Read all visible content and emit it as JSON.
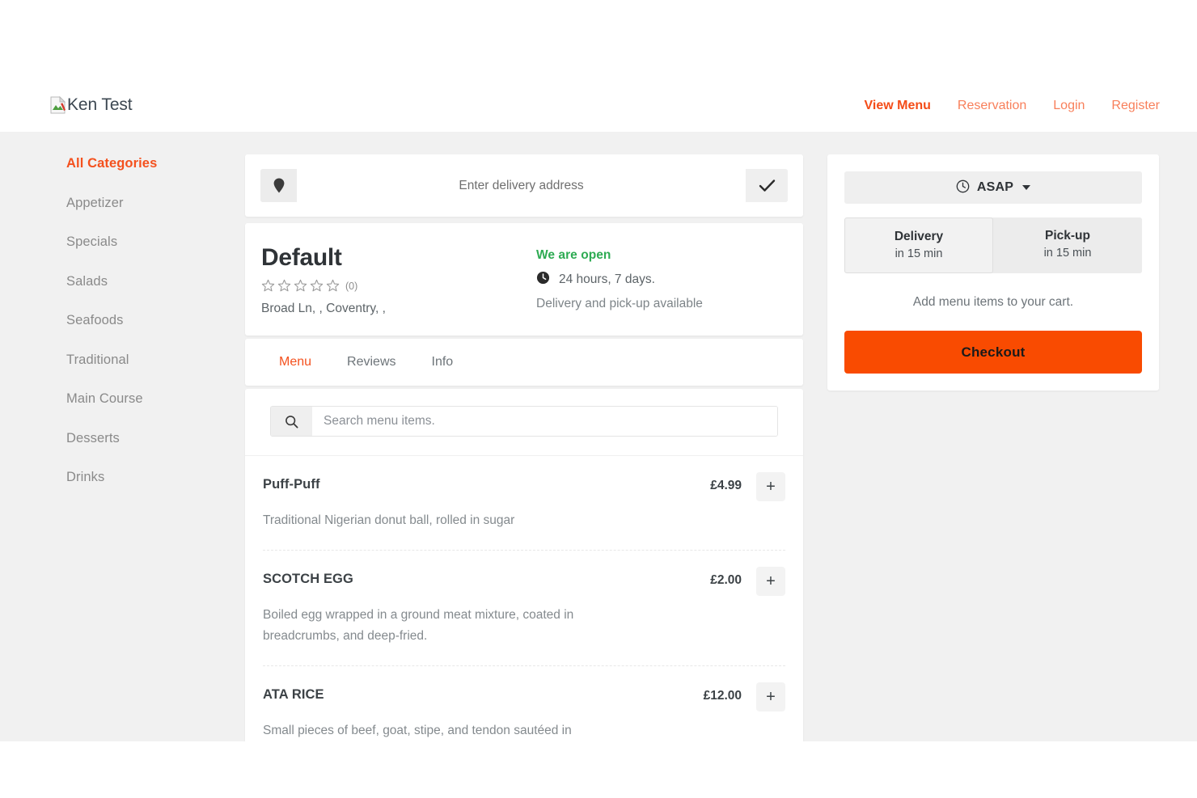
{
  "header": {
    "brand_alt": "Ken Test",
    "brand_icon": "broken-image-icon",
    "nav": [
      {
        "label": "View Menu",
        "active": true
      },
      {
        "label": "Reservation",
        "active": false
      },
      {
        "label": "Login",
        "active": false
      },
      {
        "label": "Register",
        "active": false
      }
    ]
  },
  "sidebar": {
    "items": [
      {
        "label": "All Categories",
        "active": true
      },
      {
        "label": "Appetizer",
        "active": false
      },
      {
        "label": "Specials",
        "active": false
      },
      {
        "label": "Salads",
        "active": false
      },
      {
        "label": "Seafoods",
        "active": false
      },
      {
        "label": "Traditional",
        "active": false
      },
      {
        "label": "Main Course",
        "active": false
      },
      {
        "label": "Desserts",
        "active": false
      },
      {
        "label": "Drinks",
        "active": false
      }
    ]
  },
  "address_bar": {
    "pin_icon": "location-pin-icon",
    "placeholder": "Enter delivery address",
    "value": "",
    "confirm_icon": "checkmark-icon"
  },
  "restaurant": {
    "name": "Default",
    "rating_stars": 0,
    "rating_count": "(0)",
    "address": "Broad Ln, , Coventry, ,",
    "open_status": "We are open",
    "clock_icon": "clock-icon",
    "hours": "24 hours, 7 days.",
    "availability": "Delivery and pick-up available"
  },
  "tabs": [
    {
      "label": "Menu",
      "active": true
    },
    {
      "label": "Reviews",
      "active": false
    },
    {
      "label": "Info",
      "active": false
    }
  ],
  "search": {
    "icon": "search-icon",
    "placeholder": "Search menu items.",
    "value": ""
  },
  "menu_items": [
    {
      "name": "Puff-Puff",
      "price": "£4.99",
      "description": "Traditional Nigerian donut ball, rolled in sugar",
      "add_label": "+"
    },
    {
      "name": "SCOTCH EGG",
      "price": "£2.00",
      "description": "Boiled egg wrapped in a ground meat mixture, coated in breadcrumbs, and deep-fried.",
      "add_label": "+"
    },
    {
      "name": "ATA RICE",
      "price": "£12.00",
      "description": "Small pieces of beef, goat, stipe, and tendon sautéed in",
      "add_label": "+"
    }
  ],
  "cart": {
    "timing_icon": "clock-icon",
    "timing_label": "ASAP",
    "modes": [
      {
        "title": "Delivery",
        "subtitle": "in 15 min",
        "selected": true
      },
      {
        "title": "Pick-up",
        "subtitle": "in 15 min",
        "selected": false
      }
    ],
    "empty_message": "Add menu items to your cart.",
    "checkout_label": "Checkout"
  },
  "colors": {
    "accent_orange": "#f94b01",
    "nav_orange": "#f87f5a",
    "active_orange": "#f4511e",
    "open_green": "#2eab53",
    "page_bg": "#f1f1f1"
  }
}
